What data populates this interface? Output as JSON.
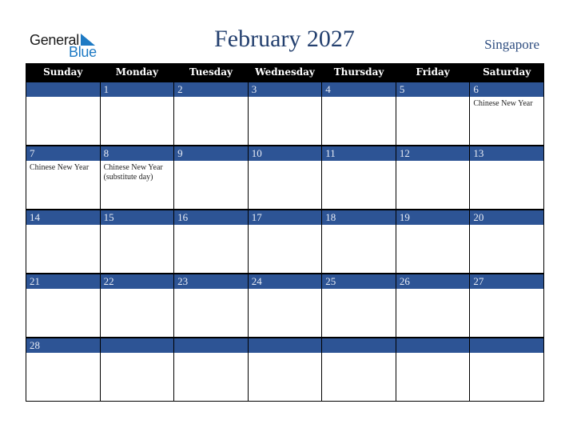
{
  "logo": {
    "line1": "General",
    "line2": "Blue"
  },
  "title": "February 2027",
  "country": "Singapore",
  "colors": {
    "header_bg": "#000000",
    "date_band": "#2d5495",
    "title": "#24406f",
    "logo_blue": "#1e7ac4"
  },
  "weekdays": [
    "Sunday",
    "Monday",
    "Tuesday",
    "Wednesday",
    "Thursday",
    "Friday",
    "Saturday"
  ],
  "weeks": [
    [
      {
        "day": "",
        "event": ""
      },
      {
        "day": "1",
        "event": ""
      },
      {
        "day": "2",
        "event": ""
      },
      {
        "day": "3",
        "event": ""
      },
      {
        "day": "4",
        "event": ""
      },
      {
        "day": "5",
        "event": ""
      },
      {
        "day": "6",
        "event": "Chinese New Year"
      }
    ],
    [
      {
        "day": "7",
        "event": "Chinese New Year"
      },
      {
        "day": "8",
        "event": "Chinese New Year (substitute day)"
      },
      {
        "day": "9",
        "event": ""
      },
      {
        "day": "10",
        "event": ""
      },
      {
        "day": "11",
        "event": ""
      },
      {
        "day": "12",
        "event": ""
      },
      {
        "day": "13",
        "event": ""
      }
    ],
    [
      {
        "day": "14",
        "event": ""
      },
      {
        "day": "15",
        "event": ""
      },
      {
        "day": "16",
        "event": ""
      },
      {
        "day": "17",
        "event": ""
      },
      {
        "day": "18",
        "event": ""
      },
      {
        "day": "19",
        "event": ""
      },
      {
        "day": "20",
        "event": ""
      }
    ],
    [
      {
        "day": "21",
        "event": ""
      },
      {
        "day": "22",
        "event": ""
      },
      {
        "day": "23",
        "event": ""
      },
      {
        "day": "24",
        "event": ""
      },
      {
        "day": "25",
        "event": ""
      },
      {
        "day": "26",
        "event": ""
      },
      {
        "day": "27",
        "event": ""
      }
    ],
    [
      {
        "day": "28",
        "event": ""
      },
      {
        "day": "",
        "event": ""
      },
      {
        "day": "",
        "event": ""
      },
      {
        "day": "",
        "event": ""
      },
      {
        "day": "",
        "event": ""
      },
      {
        "day": "",
        "event": ""
      },
      {
        "day": "",
        "event": ""
      }
    ]
  ]
}
